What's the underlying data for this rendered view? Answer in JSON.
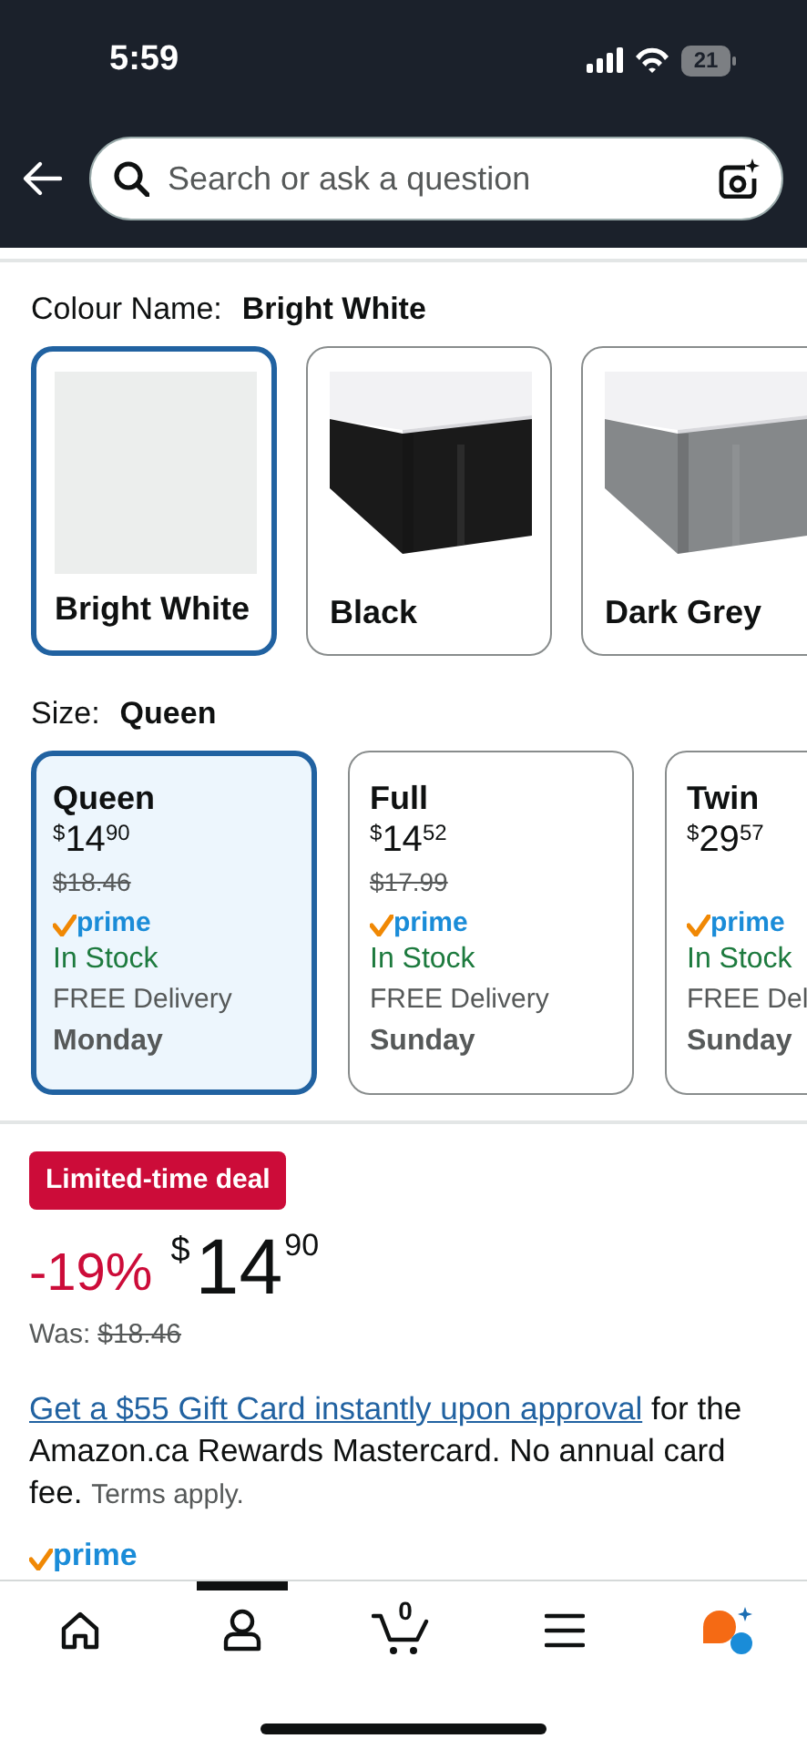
{
  "status_bar": {
    "time": "5:59",
    "battery": "21"
  },
  "search": {
    "placeholder": "Search or ask a question"
  },
  "colour": {
    "label": "Colour Name:",
    "value": "Bright White",
    "swatches": [
      {
        "label": "Bright White",
        "selected": true,
        "color": "#eceeed",
        "kind": "plain"
      },
      {
        "label": "Black",
        "selected": false,
        "color": "#1a1a1a",
        "kind": "skirt"
      },
      {
        "label": "Dark Grey",
        "selected": false,
        "color": "#85888a",
        "kind": "skirt"
      }
    ]
  },
  "size": {
    "label": "Size:",
    "value": "Queen",
    "options": [
      {
        "name": "Queen",
        "currency": "$",
        "whole": "14",
        "fraction": "90",
        "list_price": "$18.46",
        "prime": "prime",
        "stock": "In Stock",
        "delivery": "FREE Delivery",
        "day": "Monday",
        "selected": true
      },
      {
        "name": "Full",
        "currency": "$",
        "whole": "14",
        "fraction": "52",
        "list_price": "$17.99",
        "prime": "prime",
        "stock": "In Stock",
        "delivery": "FREE Delivery",
        "day": "Sunday",
        "selected": false
      },
      {
        "name": "Twin",
        "currency": "$",
        "whole": "29",
        "fraction": "57",
        "prime": "prime",
        "stock": "In Stock",
        "delivery": "FREE Del",
        "day": "Sunday",
        "selected": false
      }
    ]
  },
  "deal": {
    "badge": "Limited-time deal",
    "discount": "-19%",
    "currency": "$",
    "whole": "14",
    "fraction": "90",
    "was_label": "Was:",
    "was_price": "$18.46"
  },
  "promo": {
    "link": "Get a $55 Gift Card instantly upon approval",
    "text": "for the Amazon.ca Rewards Mastercard. No annual card fee.",
    "terms": "Terms apply."
  },
  "prime": "prime",
  "nav": [
    {
      "kind": "home",
      "selected": false
    },
    {
      "kind": "account",
      "selected": true
    },
    {
      "kind": "cart",
      "count": "0",
      "selected": false
    },
    {
      "kind": "menu",
      "selected": false
    },
    {
      "kind": "assistant",
      "selected": false
    }
  ]
}
